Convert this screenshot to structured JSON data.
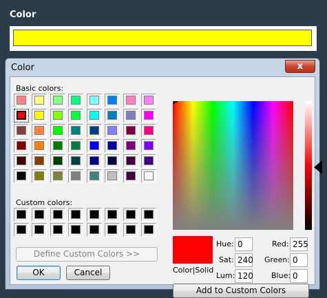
{
  "background": {
    "label": "Color",
    "swatch_color": "#ffff00",
    "page_color": "#2c3b4a"
  },
  "dialog": {
    "title": "Color",
    "close_glyph": "x",
    "basic_colors_label": "Basic colors:",
    "custom_colors_label": "Custom colors:",
    "basic_colors": [
      "#ff8080",
      "#ffff80",
      "#80ff80",
      "#00ff80",
      "#80ffff",
      "#0080ff",
      "#ff80c0",
      "#ff80ff",
      "#ff0000",
      "#ffff00",
      "#80ff00",
      "#00ff40",
      "#00ffff",
      "#0080c0",
      "#8080c0",
      "#ff00ff",
      "#804040",
      "#ff8040",
      "#00ff00",
      "#008080",
      "#004080",
      "#8080ff",
      "#800040",
      "#ff0080",
      "#800000",
      "#ff8000",
      "#008000",
      "#008040",
      "#0000ff",
      "#0000a0",
      "#800080",
      "#8000ff",
      "#400000",
      "#804000",
      "#004000",
      "#004040",
      "#000080",
      "#000040",
      "#400040",
      "#400080",
      "#000000",
      "#808000",
      "#808040",
      "#808080",
      "#408080",
      "#c0c0c0",
      "#400040",
      "#ffffff"
    ],
    "selected_basic_index": 8,
    "custom_colors": [
      "#000000",
      "#000000",
      "#000000",
      "#000000",
      "#000000",
      "#000000",
      "#000000",
      "#000000",
      "#000000",
      "#000000",
      "#000000",
      "#000000",
      "#000000",
      "#000000",
      "#000000",
      "#000000"
    ],
    "define_custom_label": "Define Custom Colors >>",
    "ok_label": "OK",
    "cancel_label": "Cancel",
    "preview_color": "#ff0000",
    "preview_label": "Color|Solid",
    "hue_label": "Hue:",
    "hue_value": "0",
    "sat_label": "Sat:",
    "sat_value": "240",
    "lum_label": "Lum:",
    "lum_value": "120",
    "red_label": "Red:",
    "red_value": "255",
    "green_label": "Green:",
    "green_value": "0",
    "blue_label": "Blue:",
    "blue_value": "0",
    "add_custom_label": "Add to Custom Colors"
  }
}
